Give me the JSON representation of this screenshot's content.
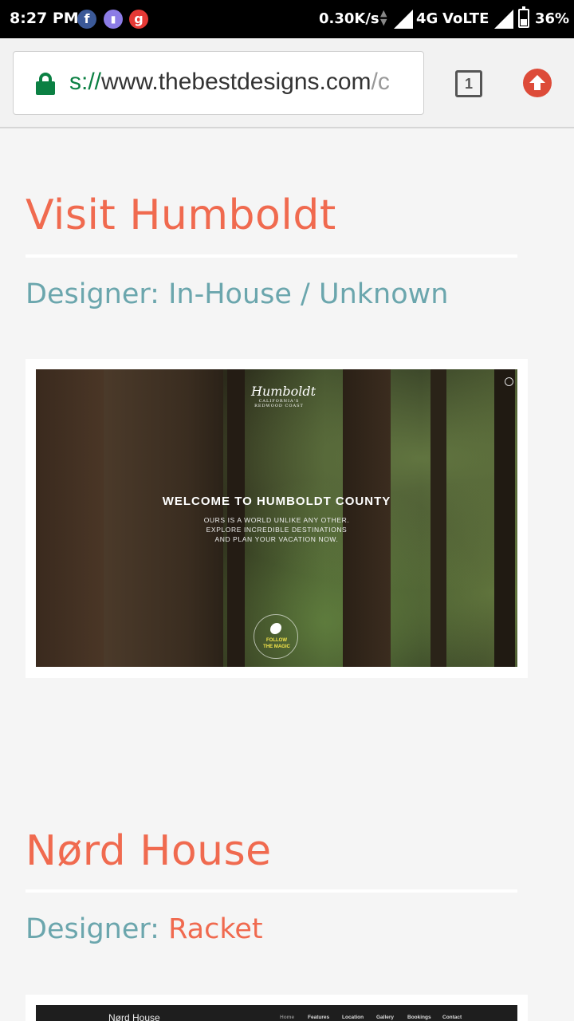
{
  "status_bar": {
    "time": "8:27 PM",
    "notification_icons": [
      "facebook-icon",
      "app-icon",
      "gaana-icon"
    ],
    "network_speed": "0.30K/s",
    "network_type": "4G",
    "volte": "VoLTE",
    "battery": "36%"
  },
  "browser": {
    "url_scheme_visible": "s://",
    "url_host": "www.thebestdesigns.com",
    "url_tail": "/c",
    "tab_count": "1",
    "secure": true
  },
  "entries": [
    {
      "title": "Visit Humboldt",
      "designer_label": "Designer:",
      "designer_name": "In-House / Unknown",
      "screenshot": {
        "logo": "Humboldt",
        "logo_sub": "CALIFORNIA'S REDWOOD COAST",
        "headline": "WELCOME TO HUMBOLDT COUNTY",
        "sub_lines": [
          "OURS IS A WORLD UNLIKE ANY OTHER.",
          "EXPLORE INCREDIBLE DESTINATIONS",
          "AND PLAN YOUR VACATION NOW."
        ],
        "badge": [
          "FOLLOW",
          "THE MAGIC"
        ]
      }
    },
    {
      "title": "Nørd House",
      "designer_label": "Designer:",
      "designer_name": "Racket",
      "screenshot": {
        "brand": "Nørd House",
        "nav": [
          "Home",
          "Features",
          "Location",
          "Gallery",
          "Bookings",
          "Contact"
        ]
      }
    }
  ],
  "colors": {
    "title": "#f06a4f",
    "designer": "#6ba6ad",
    "accent": "#f06a4f",
    "lock": "#0b8043",
    "upload": "#dd4b39"
  }
}
